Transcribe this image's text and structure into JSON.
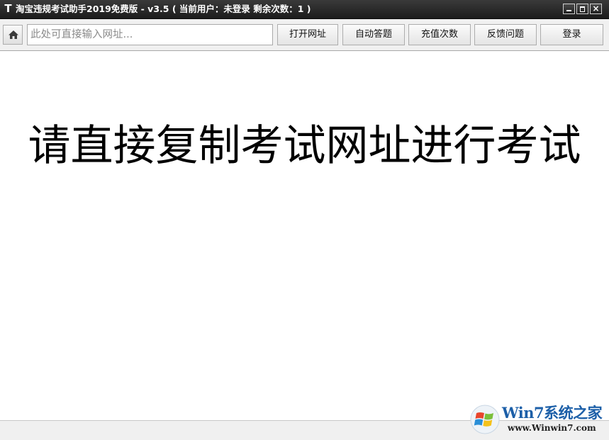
{
  "window": {
    "app_icon_glyph": "T",
    "title": "淘宝违规考试助手2019免费版 - v3.5 ( 当前用户：未登录  剩余次数：1 )",
    "close_glyph": "×"
  },
  "toolbar": {
    "url_placeholder": "此处可直接输入网址...",
    "url_value": "",
    "open_url_label": "打开网址",
    "auto_answer_label": "自动答题",
    "recharge_label": "充值次数",
    "feedback_label": "反馈问题",
    "login_label": "登录"
  },
  "main": {
    "headline": "请直接复制考试网址进行考试"
  },
  "watermark": {
    "brand": "Win7系统之家",
    "url": "www.Winwin7.com"
  },
  "icons": {
    "home": "home-icon",
    "minimize": "minimize-icon",
    "maximize": "maximize-icon",
    "close": "close-icon"
  },
  "colors": {
    "titlebar": "#1c1c1c",
    "toolbar": "#f0f0f0",
    "watermark_blue": "#1c5fa8"
  }
}
